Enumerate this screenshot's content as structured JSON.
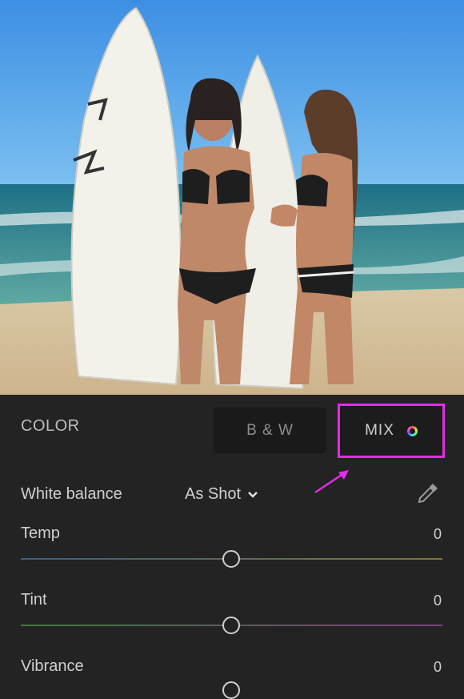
{
  "panel": {
    "section_title": "COLOR",
    "tabs": [
      {
        "label": "B & W"
      },
      {
        "label": "MIX"
      }
    ],
    "white_balance": {
      "label": "White balance",
      "value": "As Shot"
    },
    "sliders": [
      {
        "label": "Temp",
        "value": "0",
        "level": 0.5,
        "gradient": [
          "#3f5d7d",
          "#7a7a3a"
        ]
      },
      {
        "label": "Tint",
        "value": "0",
        "level": 0.5,
        "gradient": [
          "#3f7a3f",
          "#7a3f7a"
        ]
      },
      {
        "label": "Vibrance",
        "value": "0",
        "level": 0.5,
        "gradient": [
          "#555555",
          "#555555"
        ]
      }
    ]
  },
  "colors": {
    "highlight": "#e52ce8",
    "panel_bg": "#232323"
  },
  "icons": {
    "mix": "color-wheel-icon",
    "dropdown": "chevron-down-icon",
    "eyedropper": "eyedropper-icon",
    "annotation": "arrow-icon"
  }
}
